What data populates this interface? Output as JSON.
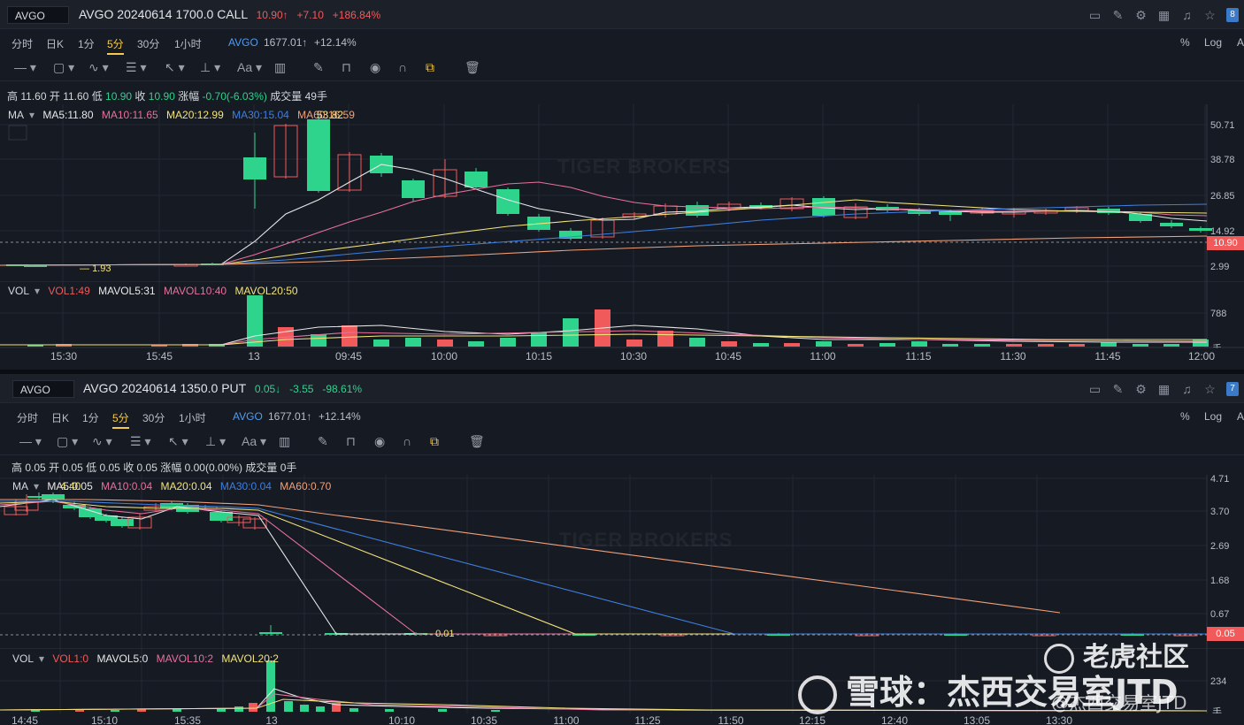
{
  "panel1": {
    "symbol": "AVGO",
    "title": "AVGO 20240614 1700.0 CALL",
    "price": "10.90↑",
    "change": "+7.10",
    "change_pct": "+186.84%",
    "badge": "8",
    "timeframes": [
      "分时",
      "日K",
      "1分",
      "5分",
      "30分",
      "1小时"
    ],
    "active_timeframe": "5分",
    "underlying_label": "AVGO",
    "underlying_price": "1677.01↑",
    "underlying_change": "+12.14%",
    "right_opts": [
      "%",
      "Log",
      "A"
    ],
    "ohlc": {
      "high_label": "高",
      "high": "11.60",
      "open_label": "开",
      "open": "11.60",
      "low_label": "低",
      "low": "10.90",
      "close_label": "收",
      "close": "10.90",
      "amp_label": "涨幅",
      "amp": "-0.70(-6.03%)",
      "vol_label": "成交量",
      "vol": "49手"
    },
    "ma_legend": [
      "MA",
      "MA5:11.80",
      "MA10:11.65",
      "MA20:12.99",
      "MA30:15.04",
      "MA60:16.59"
    ],
    "ma_overlap_label": "53.82",
    "low_marker": "1.93",
    "y_ticks": [
      "50.71",
      "38.78",
      "26.85",
      "14.92",
      "2.99"
    ],
    "price_tag": "10.90",
    "vol_legend": [
      "VOL",
      "VOL1:49",
      "MAVOL5:31",
      "MAVOL10:40",
      "MAVOL20:50"
    ],
    "vol_tick": "788",
    "vol_unit": "手",
    "x_labels": [
      "15:30",
      "15:45",
      "13",
      "09:45",
      "10:00",
      "10:15",
      "10:30",
      "10:45",
      "11:00",
      "11:15",
      "11:30",
      "11:45",
      "12:00"
    ],
    "watermark": "TIGER BROKERS"
  },
  "panel2": {
    "symbol": "AVGO",
    "title": "AVGO 20240614 1350.0 PUT",
    "price": "0.05↓",
    "change": "-3.55",
    "change_pct": "-98.61%",
    "badge": "7",
    "timeframes": [
      "分时",
      "日K",
      "1分",
      "5分",
      "30分",
      "1小时"
    ],
    "active_timeframe": "5分",
    "underlying_label": "AVGO",
    "underlying_price": "1677.01↑",
    "underlying_change": "+12.14%",
    "right_opts": [
      "%",
      "Log",
      "A"
    ],
    "ohlc": {
      "high_label": "高",
      "high": "0.05",
      "open_label": "开",
      "open": "0.05",
      "low_label": "低",
      "low": "0.05",
      "close_label": "收",
      "close": "0.05",
      "amp_label": "涨幅",
      "amp": "0.00(0.00%)",
      "vol_label": "成交量",
      "vol": "0手"
    },
    "ma_legend": [
      "MA",
      "MA5:0.05",
      "MA10:0.04",
      "MA20:0.04",
      "MA30:0.04",
      "MA60:0.70"
    ],
    "ma_overlap_label": "4.40",
    "low_marker": "0.01",
    "y_ticks": [
      "4.71",
      "3.70",
      "2.69",
      "1.68",
      "0.67"
    ],
    "price_tag": "0.05",
    "vol_legend": [
      "VOL",
      "VOL1:0",
      "MAVOL5:0",
      "MAVOL10:2",
      "MAVOL20:2"
    ],
    "vol_tick": "234",
    "vol_unit": "手",
    "x_labels": [
      "14:45",
      "15:10",
      "15:35",
      "13",
      "10:10",
      "10:35",
      "11:00",
      "11:25",
      "11:50",
      "12:15",
      "12:40",
      "13:05",
      "13:30"
    ],
    "watermark": "TIGER BROKERS"
  },
  "overlay": {
    "text1": "老虎社区",
    "text2": "雪球：杰西交易室JTD",
    "text3": "@杰西交易室JTD"
  },
  "colors": {
    "up": "#f05a5a",
    "down": "#2ed38c",
    "ma5": "#e8e8e8",
    "ma10": "#e8719c",
    "ma20": "#f2e37a",
    "ma30": "#3e7fe0",
    "ma60": "#f2a07a"
  }
}
